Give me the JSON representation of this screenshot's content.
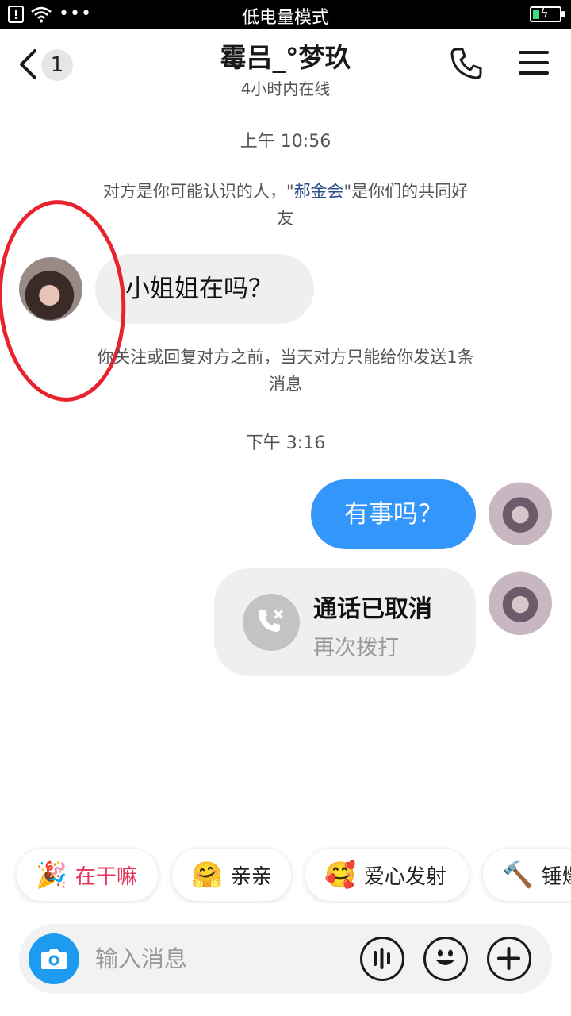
{
  "status_bar": {
    "title": "低电量模式"
  },
  "header": {
    "back_count": "1",
    "contact_name": "霉吕_°梦玖",
    "online_status": "4小时内在线"
  },
  "messages": {
    "time_1": "上午 10:56",
    "mutual_note_prefix": "对方是你可能认识的人，\"",
    "mutual_friend": "郝金会",
    "mutual_note_suffix": "\"是你们的共同好友",
    "incoming_text": "小姐姐在吗？",
    "limit_note": "你关注或回复对方之前，当天对方只能给你发送1条消息",
    "time_2": "下午 3:16",
    "outgoing_text": "有事吗？",
    "call_card": {
      "title": "通话已取消",
      "action": "再次拨打"
    }
  },
  "quick_replies": [
    {
      "label": "在干嘛",
      "icon": "party-emoji-icon"
    },
    {
      "label": "亲亲",
      "icon": "hug-emoji-icon"
    },
    {
      "label": "爱心发射",
      "icon": "hearts-emoji-icon"
    },
    {
      "label": "锤爆",
      "icon": "hammer-emoji-icon"
    }
  ],
  "input": {
    "placeholder": "输入消息"
  },
  "colors": {
    "accent": "#3296fa",
    "annotation": "#e8232f",
    "link": "#2a4f8c"
  }
}
